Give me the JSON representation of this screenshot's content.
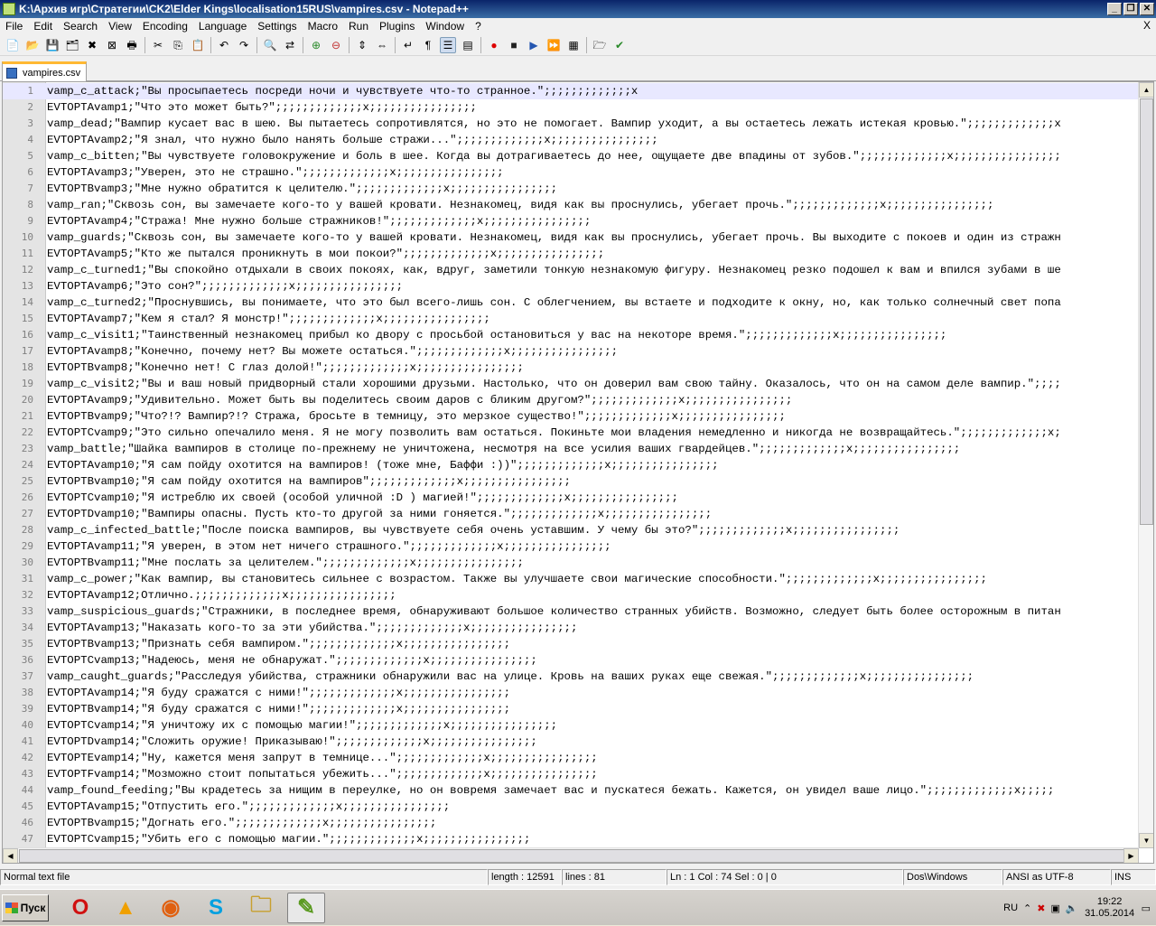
{
  "window": {
    "title": "K:\\Архив игр\\Стратегии\\CK2\\Elder Kings\\localisation15RUS\\vampires.csv - Notepad++",
    "buttons": {
      "minimize": "_",
      "restore": "❐",
      "close": "✕"
    }
  },
  "menu": [
    "File",
    "Edit",
    "Search",
    "View",
    "Encoding",
    "Language",
    "Settings",
    "Macro",
    "Run",
    "Plugins",
    "Window",
    "?"
  ],
  "menu_close": "X",
  "toolbar_icons": [
    "new-file-icon",
    "open-file-icon",
    "save-icon",
    "save-all-icon",
    "close-icon",
    "close-all-icon",
    "print-icon",
    "cut-icon",
    "copy-icon",
    "paste-icon",
    "undo-icon",
    "redo-icon",
    "find-icon",
    "replace-icon",
    "zoom-in-icon",
    "zoom-out-icon",
    "sync-vertical-icon",
    "sync-horizontal-icon",
    "word-wrap-icon",
    "show-all-chars-icon",
    "indent-guide-icon",
    "user-lang-icon",
    "record-macro-icon",
    "stop-record-icon",
    "play-macro-icon",
    "run-macro-multiple-icon",
    "save-macro-icon",
    "folder-as-workspace-icon",
    "spellcheck-icon"
  ],
  "tab": {
    "label": "vampires.csv"
  },
  "lines": [
    {
      "n": "1",
      "t": "vamp_c_attack;\"Вы просыпаетесь посреди ночи и чувствуете что-то странное.\";;;;;;;;;;;;;x"
    },
    {
      "n": "2",
      "t": "EVTOPTAvamp1;\"Что это может быть?\";;;;;;;;;;;;;x;;;;;;;;;;;;;;;;"
    },
    {
      "n": "3",
      "t": "vamp_dead;\"Вампир кусает вас в шею. Вы пытаетесь сопротивлятся, но это не помогает. Вампир уходит, а вы остаетесь лежать истекая кровью.\";;;;;;;;;;;;;x"
    },
    {
      "n": "4",
      "t": "EVTOPTAvamp2;\"Я знал, что нужно было нанять больше стражи...\";;;;;;;;;;;;;x;;;;;;;;;;;;;;;;"
    },
    {
      "n": "5",
      "t": "vamp_c_bitten;\"Вы чувствуете головокружение и боль в шее. Когда вы дотрагиваетесь до нее, ощущаете две впадины от зубов.\";;;;;;;;;;;;;x;;;;;;;;;;;;;;;;"
    },
    {
      "n": "6",
      "t": "EVTOPTAvamp3;\"Уверен, это не страшно.\";;;;;;;;;;;;;x;;;;;;;;;;;;;;;;"
    },
    {
      "n": "7",
      "t": "EVTOPTBvamp3;\"Мне нужно обратится к целителю.\";;;;;;;;;;;;;x;;;;;;;;;;;;;;;;"
    },
    {
      "n": "8",
      "t": "vamp_ran;\"Сквозь сон, вы замечаете кого-то у вашей кровати. Незнакомец, видя как вы проснулись, убегает прочь.\";;;;;;;;;;;;;x;;;;;;;;;;;;;;;;"
    },
    {
      "n": "9",
      "t": "EVTOPTAvamp4;\"Стража! Мне нужно больше стражников!\";;;;;;;;;;;;;x;;;;;;;;;;;;;;;;"
    },
    {
      "n": "10",
      "t": "vamp_guards;\"Сквозь сон, вы замечаете кого-то у вашей кровати. Незнакомец, видя как вы проснулись, убегает прочь. Вы выходите с покоев и один из стражн"
    },
    {
      "n": "11",
      "t": "EVTOPTAvamp5;\"Кто же пытался проникнуть в мои покои?\";;;;;;;;;;;;;x;;;;;;;;;;;;;;;;"
    },
    {
      "n": "12",
      "t": "vamp_c_turned1;\"Вы спокойно отдыхали в своих покоях, как, вдруг, заметили тонкую незнакомую фигуру. Незнакомец резко подошел к вам и впился зубами в ше"
    },
    {
      "n": "13",
      "t": "EVTOPTAvamp6;\"Это сон?\";;;;;;;;;;;;;x;;;;;;;;;;;;;;;;"
    },
    {
      "n": "14",
      "t": "vamp_c_turned2;\"Проснувшись, вы понимаете, что это был всего-лишь сон. С облегчением, вы встаете и подходите к окну, но, как только солнечный свет попа"
    },
    {
      "n": "15",
      "t": "EVTOPTAvamp7;\"Кем я стал? Я монстр!\";;;;;;;;;;;;;x;;;;;;;;;;;;;;;;"
    },
    {
      "n": "16",
      "t": "vamp_c_visit1;\"Таинственный незнакомец прибыл ко двору с просьбой остановиться у вас на некоторе время.\";;;;;;;;;;;;;x;;;;;;;;;;;;;;;;"
    },
    {
      "n": "17",
      "t": "EVTOPTAvamp8;\"Конечно, почему нет? Вы можете остаться.\";;;;;;;;;;;;;x;;;;;;;;;;;;;;;;"
    },
    {
      "n": "18",
      "t": "EVTOPTBvamp8;\"Конечно нет! С глаз долой!\";;;;;;;;;;;;;x;;;;;;;;;;;;;;;;"
    },
    {
      "n": "19",
      "t": "vamp_c_visit2;\"Вы и ваш новый придворный стали хорошими друзьми. Настолько, что он доверил вам свою тайну. Оказалось, что он на самом деле вампир.\";;;;"
    },
    {
      "n": "20",
      "t": "EVTOPTAvamp9;\"Удивительно. Может быть вы поделитесь своим даров с бликим другом?\";;;;;;;;;;;;;x;;;;;;;;;;;;;;;;"
    },
    {
      "n": "21",
      "t": "EVTOPTBvamp9;\"Что?!? Вампир?!? Стража, бросьте в темницу, это мерзкое существо!\";;;;;;;;;;;;;x;;;;;;;;;;;;;;;;"
    },
    {
      "n": "22",
      "t": "EVTOPTCvamp9;\"Это сильно опечалило меня. Я не могу позволить вам остаться. Покиньте мои владения немедленно и никогда не возвращайтесь.\";;;;;;;;;;;;;x;"
    },
    {
      "n": "23",
      "t": "vamp_battle;\"Шайка вампиров в столице по-прежнему не уничтожена, несмотря на все усилия ваших гвардейцев.\";;;;;;;;;;;;;x;;;;;;;;;;;;;;;;"
    },
    {
      "n": "24",
      "t": "EVTOPTAvamp10;\"Я сам пойду охотится на вампиров! (тоже мне, Баффи :))\";;;;;;;;;;;;;x;;;;;;;;;;;;;;;;"
    },
    {
      "n": "25",
      "t": "EVTOPTBvamp10;\"Я сам пойду охотится на вампиров\";;;;;;;;;;;;;x;;;;;;;;;;;;;;;;"
    },
    {
      "n": "26",
      "t": "EVTOPTCvamp10;\"Я истреблю их своей (особой уличной :D ) магией!\";;;;;;;;;;;;;x;;;;;;;;;;;;;;;;"
    },
    {
      "n": "27",
      "t": "EVTOPTDvamp10;\"Вампиры опасны. Пусть кто-то другой за ними гоняется.\";;;;;;;;;;;;;x;;;;;;;;;;;;;;;;"
    },
    {
      "n": "28",
      "t": "vamp_c_infected_battle;\"После поиска вампиров, вы чувствуете себя очень уставшим. У чему бы это?\";;;;;;;;;;;;;x;;;;;;;;;;;;;;;;"
    },
    {
      "n": "29",
      "t": "EVTOPTAvamp11;\"Я уверен, в этом нет ничего страшного.\";;;;;;;;;;;;;x;;;;;;;;;;;;;;;;"
    },
    {
      "n": "30",
      "t": "EVTOPTBvamp11;\"Мне послать за целителем.\";;;;;;;;;;;;;x;;;;;;;;;;;;;;;;"
    },
    {
      "n": "31",
      "t": "vamp_c_power;\"Как вампир, вы становитесь сильнее с возрастом. Также вы улучшаете свои магические способности.\";;;;;;;;;;;;;x;;;;;;;;;;;;;;;;"
    },
    {
      "n": "32",
      "t": "EVTOPTAvamp12;Отлично.;;;;;;;;;;;;;x;;;;;;;;;;;;;;;;"
    },
    {
      "n": "33",
      "t": "vamp_suspicious_guards;\"Стражники, в последнее время, обнаруживают большое количество странных убийств. Возможно, следует быть более осторожным в питан"
    },
    {
      "n": "34",
      "t": "EVTOPTAvamp13;\"Наказать кого-то за эти убийства.\";;;;;;;;;;;;;x;;;;;;;;;;;;;;;;"
    },
    {
      "n": "35",
      "t": "EVTOPTBvamp13;\"Признать себя вампиром.\";;;;;;;;;;;;;x;;;;;;;;;;;;;;;;"
    },
    {
      "n": "36",
      "t": "EVTOPTCvamp13;\"Надеюсь, меня не обнаружат.\";;;;;;;;;;;;;x;;;;;;;;;;;;;;;;"
    },
    {
      "n": "37",
      "t": "vamp_caught_guards;\"Расследуя убийства, стражники обнаружили вас на улице. Кровь на ваших руках еще свежая.\";;;;;;;;;;;;;x;;;;;;;;;;;;;;;;"
    },
    {
      "n": "38",
      "t": "EVTOPTAvamp14;\"Я буду сражатся с ними!\";;;;;;;;;;;;;x;;;;;;;;;;;;;;;;"
    },
    {
      "n": "39",
      "t": "EVTOPTBvamp14;\"Я буду сражатся с ними!\";;;;;;;;;;;;;x;;;;;;;;;;;;;;;;"
    },
    {
      "n": "40",
      "t": "EVTOPTCvamp14;\"Я уничтожу их с помощью магии!\";;;;;;;;;;;;;x;;;;;;;;;;;;;;;;"
    },
    {
      "n": "41",
      "t": "EVTOPTDvamp14;\"Сложить оружие! Приказываю!\";;;;;;;;;;;;;x;;;;;;;;;;;;;;;;"
    },
    {
      "n": "42",
      "t": "EVTOPTEvamp14;\"Ну, кажется меня запрут в темнице...\";;;;;;;;;;;;;x;;;;;;;;;;;;;;;;"
    },
    {
      "n": "43",
      "t": "EVTOPTFvamp14;\"Мозможно стоит попытаться убежить...\";;;;;;;;;;;;;x;;;;;;;;;;;;;;;;"
    },
    {
      "n": "44",
      "t": "vamp_found_feeding;\"Вы крадетесь за нищим в переулке, но он вовремя замечает вас и пускатеся бежать. Кажется, он увидел ваше лицо.\";;;;;;;;;;;;;x;;;;;"
    },
    {
      "n": "45",
      "t": "EVTOPTAvamp15;\"Отпустить его.\";;;;;;;;;;;;;x;;;;;;;;;;;;;;;;"
    },
    {
      "n": "46",
      "t": "EVTOPTBvamp15;\"Догнать его.\";;;;;;;;;;;;;x;;;;;;;;;;;;;;;;"
    },
    {
      "n": "47",
      "t": "EVTOPTCvamp15;\"Убить его с помощью магии.\";;;;;;;;;;;;;x;;;;;;;;;;;;;;;;"
    }
  ],
  "status": {
    "type": "Normal text file",
    "length": "length : 12591",
    "lines": "lines : 81",
    "pos": "Ln : 1    Col : 74    Sel : 0 | 0",
    "eol": "Dos\\Windows",
    "encoding": "ANSI as UTF-8",
    "mode": "INS"
  },
  "taskbar": {
    "start": "Пуск",
    "apps": [
      "opera-icon",
      "aimp-icon",
      "firefox-icon",
      "skype-icon",
      "explorer-icon",
      "notepadpp-icon"
    ],
    "lang": "RU",
    "time": "19:22",
    "date": "31.05.2014"
  },
  "colors": {
    "title_start": "#0a246a",
    "title_end": "#3a6ea5",
    "tab_accent": "#ffb833",
    "current_line": "#e8e8ff"
  }
}
